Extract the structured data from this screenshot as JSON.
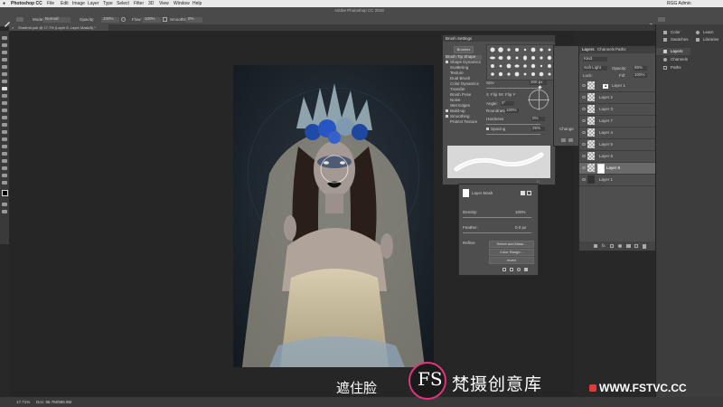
{
  "menubar": {
    "app_name": "Photoshop CC",
    "items": [
      "File",
      "Edit",
      "Image",
      "Layer",
      "Type",
      "Select",
      "Filter",
      "3D",
      "View",
      "Window",
      "Help"
    ],
    "user": "RGG Admin"
  },
  "window_title": "Adobe Photoshop CC 2018",
  "options_bar": {
    "mode_label": "Mode:",
    "mode_value": "Normal",
    "opacity_label": "Opacity:",
    "opacity_value": "100%",
    "flow_label": "Flow:",
    "flow_value": "100%",
    "smoothing_label": "Smoothing:",
    "smoothing_value": "0%"
  },
  "document_tab": "Shadmit.psb @ 17.7% (Layer 8, Layer Mask/8) *",
  "brush_settings": {
    "title": "Brush Settings",
    "brushes_button": "Brushes",
    "options": [
      {
        "label": "Brush Tip Shape",
        "checked": false
      },
      {
        "label": "Shape Dynamics",
        "checked": true
      },
      {
        "label": "Scattering",
        "checked": false
      },
      {
        "label": "Texture",
        "checked": false
      },
      {
        "label": "Dual Brush",
        "checked": false
      },
      {
        "label": "Color Dynamics",
        "checked": false
      },
      {
        "label": "Transfer",
        "checked": false
      },
      {
        "label": "Brush Pose",
        "checked": false
      },
      {
        "label": "Noise",
        "checked": false
      },
      {
        "label": "Wet Edges",
        "checked": false
      },
      {
        "label": "Build-up",
        "checked": true
      },
      {
        "label": "Smoothing",
        "checked": true
      },
      {
        "label": "Protect Texture",
        "checked": false
      }
    ],
    "size_label": "Size",
    "size_value": "300 px",
    "flip_x": "Flip X",
    "flip_y": "Flip Y",
    "angle_label": "Angle:",
    "angle_value": "0°",
    "roundness_label": "Roundness:",
    "roundness_value": "100%",
    "hardness_label": "Hardness",
    "hardness_value": "0%",
    "spacing_label": "Spacing",
    "spacing_value": "25%"
  },
  "properties": {
    "title": "Layer Mask",
    "density_label": "Density:",
    "density_value": "100%",
    "feather_label": "Feather:",
    "feather_value": "0.0 px",
    "refine_label": "Refine:",
    "select_and_mask": "Select and Mask...",
    "color_range": "Color Range...",
    "invert": "Invert"
  },
  "layers_panel": {
    "tabs": [
      "Layers",
      "Channels",
      "Paths"
    ],
    "kind": "Kind",
    "blend_mode": "Soft Light",
    "opacity_label": "Opacity:",
    "opacity_value": "85%",
    "lock_label": "Lock:",
    "fill_label": "Fill:",
    "fill_value": "100%",
    "layers": [
      "Layer 1",
      "Layer 2",
      "Layer 3",
      "Layer 7",
      "Layer 4",
      "Layer 5",
      "Layer 6",
      "Layer 8",
      "Layer 1"
    ],
    "selected_index": 7,
    "partial_labels": [
      "Change"
    ]
  },
  "right_panels": {
    "top_left": [
      "Color",
      "Swatches"
    ],
    "top_right": [
      "Learn",
      "Libraries"
    ],
    "mid": [
      "Layers",
      "Channels",
      "Paths"
    ]
  },
  "status": {
    "zoom": "17.71%",
    "doc": "Doc: 86.7M/586.9M"
  },
  "overlay": {
    "caption": "遮住脸",
    "logo_mark": "FS",
    "logo_text": "梵摄创意库",
    "site": "WWW.FSTVC.CC"
  },
  "colors": {
    "accent_pink": "#e0357a",
    "site_red": "#e23a3a",
    "brush_stroke": "#ffffff"
  }
}
